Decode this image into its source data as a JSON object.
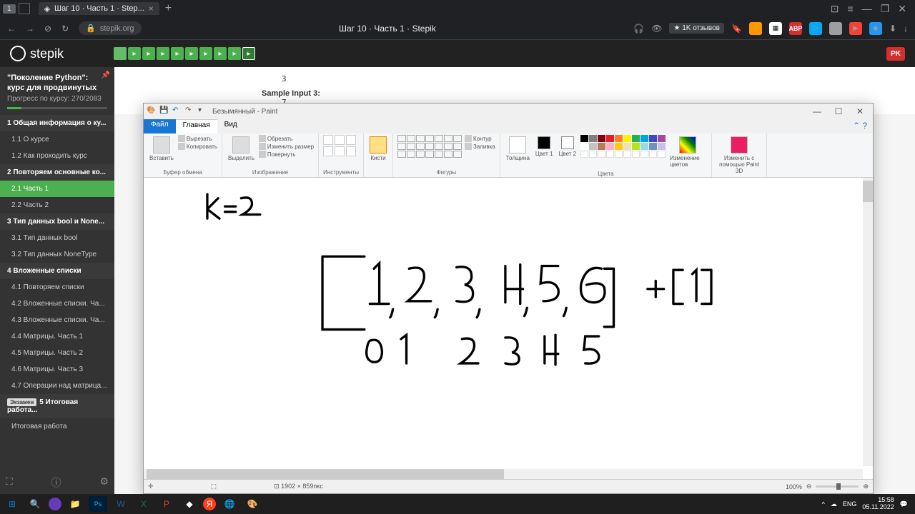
{
  "browser": {
    "tab_number": "1",
    "tab_title": "Шаг 10 · Часть 1 · Step...",
    "url_domain": "stepik.org",
    "page_title": "Шаг 10 · Часть 1 · Stepik",
    "reviews_badge": "★ 1K отзывов"
  },
  "stepik": {
    "logo_text": "stepik",
    "user_badge": "PK",
    "course_title": "\"Поколение Python\": курс для продвинутых",
    "progress_text": "Прогресс по курсу: 270/2083",
    "sections": [
      {
        "num": "1",
        "title": "Общая информация о ку...",
        "items": [
          {
            "id": "1.1",
            "title": "О курсе"
          },
          {
            "id": "1.2",
            "title": "Как проходить курс"
          }
        ]
      },
      {
        "num": "2",
        "title": "Повторяем основные ко...",
        "items": [
          {
            "id": "2.1",
            "title": "Часть 1",
            "active": true
          },
          {
            "id": "2.2",
            "title": "Часть 2"
          }
        ]
      },
      {
        "num": "3",
        "title": "Тип данных bool и None...",
        "items": [
          {
            "id": "3.1",
            "title": "Тип данных bool"
          },
          {
            "id": "3.2",
            "title": "Тип данных NoneType"
          }
        ]
      },
      {
        "num": "4",
        "title": "Вложенные списки",
        "items": [
          {
            "id": "4.1",
            "title": "Повторяем списки"
          },
          {
            "id": "4.2",
            "title": "Вложенные списки. Ча..."
          },
          {
            "id": "4.3",
            "title": "Вложенные списки. Ча..."
          },
          {
            "id": "4.4",
            "title": "Матрицы. Часть 1"
          },
          {
            "id": "4.5",
            "title": "Матрицы. Часть 2"
          },
          {
            "id": "4.6",
            "title": "Матрицы. Часть 3"
          },
          {
            "id": "4.7",
            "title": "Операции над матрица..."
          }
        ]
      },
      {
        "num": "5",
        "title": "Итоговая работа...",
        "exam": "Экзамен",
        "items": [
          {
            "id": "",
            "title": "Итоговая работа"
          }
        ]
      }
    ],
    "lesson": {
      "val_3": "3",
      "sample_input_3": "Sample Input 3:",
      "val_7": "7"
    }
  },
  "paint": {
    "title": "Безымянный - Paint",
    "tabs": {
      "file": "Файл",
      "home": "Главная",
      "view": "Вид"
    },
    "ribbon": {
      "paste": "Вставить",
      "cut": "Вырезать",
      "copy": "Копировать",
      "clipboard": "Буфер обмена",
      "select": "Выделить",
      "crop": "Обрезать",
      "resize": "Изменить размер",
      "rotate": "Повернуть",
      "image": "Изображение",
      "tools": "Инструменты",
      "brushes": "Кисти",
      "outline": "Контур",
      "fill": "Заливка",
      "shapes": "Фигуры",
      "size": "Толщина",
      "color1": "Цвет 1",
      "color2": "Цвет 2",
      "colors": "Цвета",
      "edit_colors": "Изменение цветов",
      "paint3d": "Изменить с помощью Paint 3D"
    },
    "status": {
      "dimensions": "1902 × 859пкс",
      "zoom": "100%"
    },
    "palette": [
      "#000",
      "#7f7f7f",
      "#880015",
      "#ed1c24",
      "#ff7f27",
      "#fff200",
      "#22b14c",
      "#00a2e8",
      "#3f48cc",
      "#a349a4",
      "#fff",
      "#c3c3c3",
      "#b97a57",
      "#ffaec9",
      "#ffc90e",
      "#efe4b0",
      "#b5e61d",
      "#99d9ea",
      "#7092be",
      "#c8bfe7"
    ]
  },
  "taskbar": {
    "lang": "ENG",
    "time": "15:58",
    "date": "05.11.2022"
  }
}
